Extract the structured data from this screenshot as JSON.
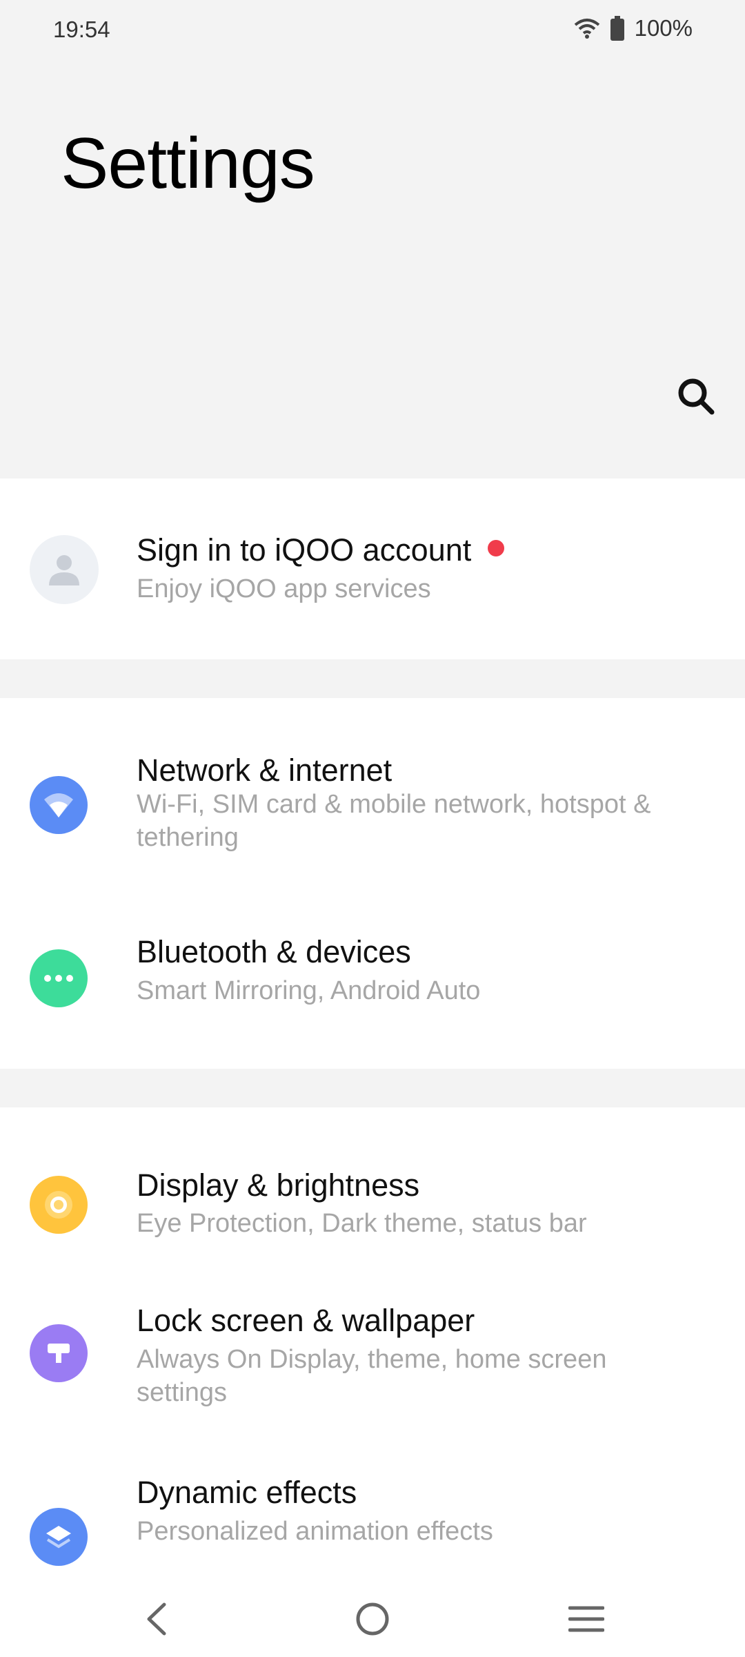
{
  "status_bar": {
    "time": "19:54",
    "battery": "100%",
    "icons": [
      "wifi-icon",
      "battery-icon"
    ]
  },
  "header": {
    "title": "Settings",
    "search_icon": "search-icon"
  },
  "account": {
    "title": "Sign in to iQOO account",
    "subtitle": "Enjoy iQOO app services",
    "notification_dot_color": "#f03c4b"
  },
  "groups": [
    {
      "items": [
        {
          "title": "Network & internet",
          "subtitle": "Wi-Fi, SIM card & mobile network, hotspot & tethering",
          "icon": "wifi-icon",
          "color": "#5b8cf5"
        },
        {
          "title": "Bluetooth & devices",
          "subtitle": "Smart Mirroring, Android Auto",
          "icon": "dots-icon",
          "color": "#3ddc9a"
        }
      ]
    },
    {
      "items": [
        {
          "title": "Display & brightness",
          "subtitle": "Eye Protection, Dark theme, status bar",
          "icon": "brightness-icon",
          "color": "#ffc43d"
        },
        {
          "title": "Lock screen & wallpaper",
          "subtitle": "Always On Display, theme, home screen settings",
          "icon": "wallpaper-icon",
          "color": "#9a7cf3"
        },
        {
          "title": "Dynamic effects",
          "subtitle": "Personalized animation effects",
          "icon": "layers-icon",
          "color": "#5b8cf5"
        }
      ]
    }
  ],
  "nav": {
    "back": "back-icon",
    "home": "home-icon",
    "menu": "menu-icon"
  }
}
